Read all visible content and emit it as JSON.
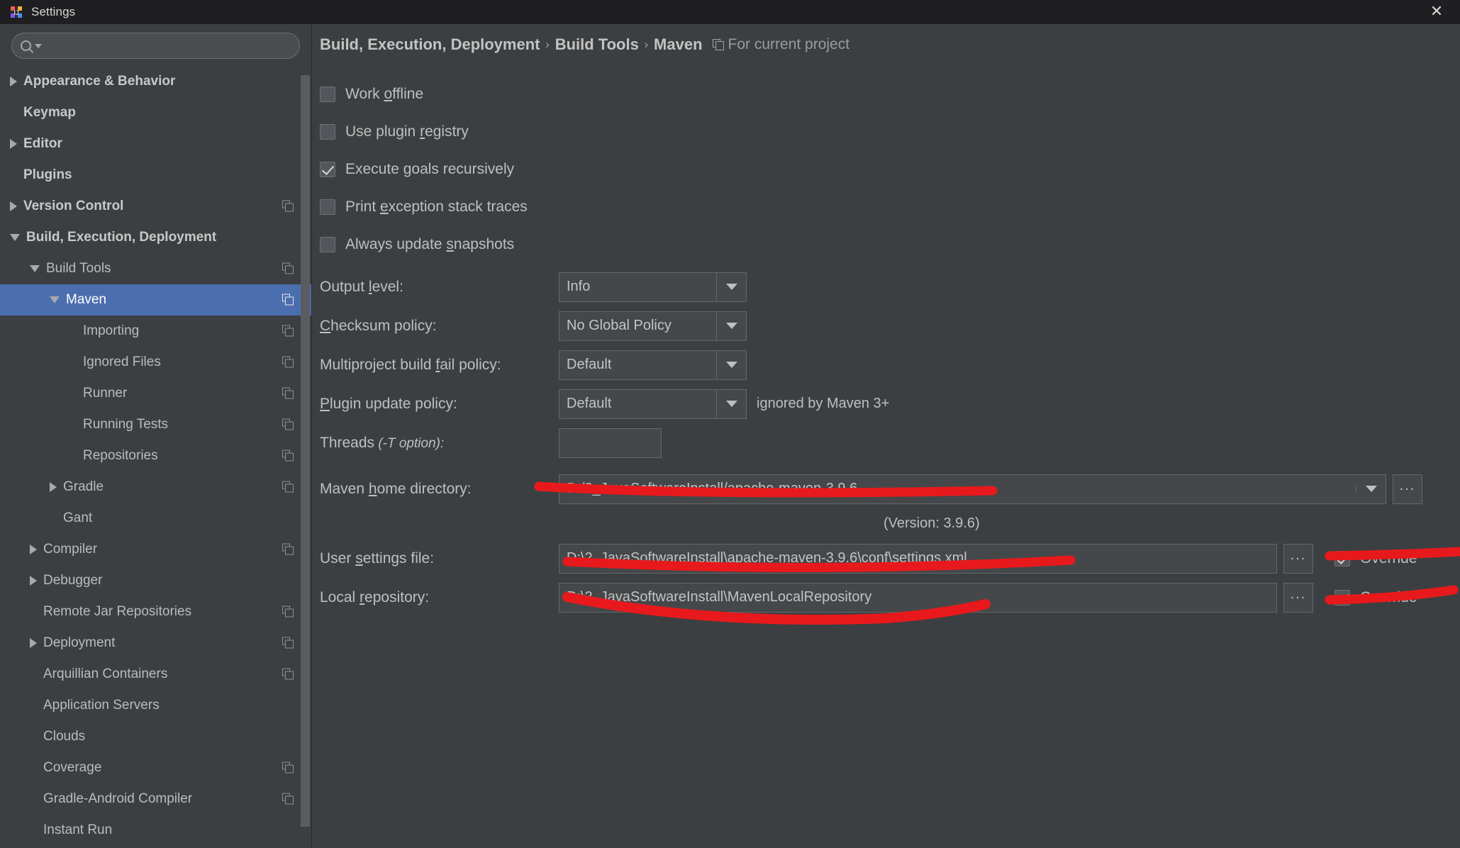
{
  "window": {
    "title": "Settings",
    "app_icon": "intellij-idea-icon",
    "close_label": "✕"
  },
  "search": {
    "value": "",
    "placeholder": "",
    "icon": "search-icon"
  },
  "sidebar": {
    "items": [
      {
        "label": "Appearance & Behavior",
        "level": 0,
        "twisty": "collapsed",
        "badge": false,
        "selected": false
      },
      {
        "label": "Keymap",
        "level": 0,
        "twisty": "none",
        "badge": false,
        "selected": false
      },
      {
        "label": "Editor",
        "level": 0,
        "twisty": "collapsed",
        "badge": false,
        "selected": false
      },
      {
        "label": "Plugins",
        "level": 0,
        "twisty": "none",
        "badge": false,
        "selected": false
      },
      {
        "label": "Version Control",
        "level": 0,
        "twisty": "collapsed",
        "badge": true,
        "selected": false
      },
      {
        "label": "Build, Execution, Deployment",
        "level": 0,
        "twisty": "expanded",
        "badge": false,
        "selected": false
      },
      {
        "label": "Build Tools",
        "level": 1,
        "twisty": "expanded",
        "badge": true,
        "selected": false
      },
      {
        "label": "Maven",
        "level": 2,
        "twisty": "expanded",
        "badge": true,
        "selected": true
      },
      {
        "label": "Importing",
        "level": 3,
        "twisty": "none",
        "badge": true,
        "selected": false
      },
      {
        "label": "Ignored Files",
        "level": 3,
        "twisty": "none",
        "badge": true,
        "selected": false
      },
      {
        "label": "Runner",
        "level": 3,
        "twisty": "none",
        "badge": true,
        "selected": false
      },
      {
        "label": "Running Tests",
        "level": 3,
        "twisty": "none",
        "badge": true,
        "selected": false
      },
      {
        "label": "Repositories",
        "level": 3,
        "twisty": "none",
        "badge": true,
        "selected": false
      },
      {
        "label": "Gradle",
        "level": 2,
        "twisty": "collapsed",
        "badge": true,
        "selected": false
      },
      {
        "label": "Gant",
        "level": 2,
        "twisty": "none",
        "badge": false,
        "selected": false
      },
      {
        "label": "Compiler",
        "level": 1,
        "twisty": "collapsed",
        "badge": true,
        "selected": false
      },
      {
        "label": "Debugger",
        "level": 1,
        "twisty": "collapsed",
        "badge": false,
        "selected": false
      },
      {
        "label": "Remote Jar Repositories",
        "level": 1,
        "twisty": "none",
        "badge": true,
        "selected": false
      },
      {
        "label": "Deployment",
        "level": 1,
        "twisty": "collapsed",
        "badge": true,
        "selected": false
      },
      {
        "label": "Arquillian Containers",
        "level": 1,
        "twisty": "none",
        "badge": true,
        "selected": false
      },
      {
        "label": "Application Servers",
        "level": 1,
        "twisty": "none",
        "badge": false,
        "selected": false
      },
      {
        "label": "Clouds",
        "level": 1,
        "twisty": "none",
        "badge": false,
        "selected": false
      },
      {
        "label": "Coverage",
        "level": 1,
        "twisty": "none",
        "badge": true,
        "selected": false
      },
      {
        "label": "Gradle-Android Compiler",
        "level": 1,
        "twisty": "none",
        "badge": true,
        "selected": false
      },
      {
        "label": "Instant Run",
        "level": 1,
        "twisty": "none",
        "badge": false,
        "selected": false
      }
    ]
  },
  "breadcrumb": {
    "crumb1": "Build, Execution, Deployment",
    "crumb2": "Build Tools",
    "crumb3": "Maven",
    "separator": "›",
    "scope_icon": "project-scope-icon",
    "scope_label": "For current project"
  },
  "checkboxes": [
    {
      "label_pre": "Work ",
      "mnemonic": "o",
      "label_post": "ffline",
      "checked": false
    },
    {
      "label_pre": "Use plugin ",
      "mnemonic": "r",
      "label_post": "egistry",
      "checked": false
    },
    {
      "label_pre": "Execute ",
      "mnemonic": "g",
      "label_post": "oals recursively",
      "checked": true
    },
    {
      "label_pre": "Print ",
      "mnemonic": "e",
      "label_post": "xception stack traces",
      "checked": false
    },
    {
      "label_pre": "Always update ",
      "mnemonic": "s",
      "label_post": "napshots",
      "checked": false
    }
  ],
  "combos": [
    {
      "label_pre": "Output ",
      "mnemonic": "l",
      "label_post": "evel:",
      "value": "Info",
      "note": ""
    },
    {
      "label_pre": "",
      "mnemonic": "C",
      "label_post": "hecksum policy:",
      "value": "No Global Policy",
      "note": ""
    },
    {
      "label_pre": "Multiproject build ",
      "mnemonic": "f",
      "label_post": "ail policy:",
      "value": "Default",
      "note": ""
    },
    {
      "label_pre": "",
      "mnemonic": "P",
      "label_post": "lugin update policy:",
      "value": "Default",
      "note": "ignored by Maven 3+"
    }
  ],
  "threads": {
    "label": "Threads",
    "hint": " (-T option):",
    "value": ""
  },
  "maven_home": {
    "label_pre": "Maven ",
    "mnemonic": "h",
    "label_post": "ome directory:",
    "value": "D:/2_JavaSoftwareInstall/apache-maven-3.9.6",
    "browse_label": "...",
    "version_note": "(Version: 3.9.6)"
  },
  "user_settings": {
    "label_pre": "User ",
    "mnemonic": "s",
    "label_post": "ettings file:",
    "value": "D:\\2_JavaSoftwareInstall\\apache-maven-3.9.6\\conf\\settings.xml",
    "browse_label": "...",
    "override_label": "Override",
    "override_checked": true
  },
  "local_repository": {
    "label_pre": "Local ",
    "mnemonic": "r",
    "label_post": "epository:",
    "value": "D:\\2_JavaSoftwareInstall\\MavenLocalRepository",
    "browse_label": "...",
    "override_label": "Override",
    "override_checked": true
  },
  "colors": {
    "window_bg": "#3c3f41",
    "titlebar_bg": "#1f1f21",
    "selection_blue": "#4b6eaf",
    "text": "#bfbfbf",
    "field_bg": "#45484a",
    "annotation_red": "#e8191c"
  }
}
